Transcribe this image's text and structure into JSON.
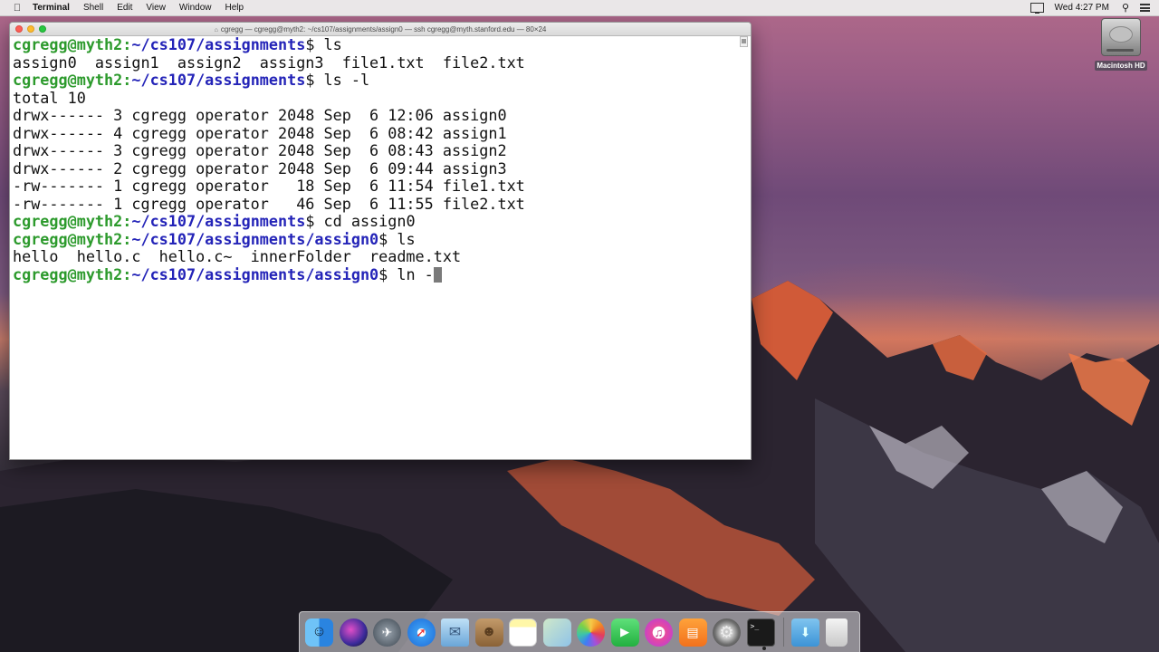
{
  "menubar": {
    "apple_icon": "apple-icon",
    "app_name": "Terminal",
    "items": [
      "Shell",
      "Edit",
      "View",
      "Window",
      "Help"
    ],
    "clock": "Wed 4:27 PM"
  },
  "desktop": {
    "drive_label": "Macintosh HD"
  },
  "terminal": {
    "title": "cgregg — cgregg@myth2: ~/cs107/assignments/assign0 — ssh cgregg@myth.stanford.edu — 80×24",
    "lines": [
      {
        "user": "cgregg@myth2",
        "path": "~/cs107/assignments",
        "cmd": "$ ls"
      },
      {
        "text": "assign0  assign1  assign2  assign3  file1.txt  file2.txt"
      },
      {
        "user": "cgregg@myth2",
        "path": "~/cs107/assignments",
        "cmd": "$ ls -l"
      },
      {
        "text": "total 10"
      },
      {
        "text": "drwx------ 3 cgregg operator 2048 Sep  6 12:06 assign0"
      },
      {
        "text": "drwx------ 4 cgregg operator 2048 Sep  6 08:42 assign1"
      },
      {
        "text": "drwx------ 3 cgregg operator 2048 Sep  6 08:43 assign2"
      },
      {
        "text": "drwx------ 2 cgregg operator 2048 Sep  6 09:44 assign3"
      },
      {
        "text": "-rw------- 1 cgregg operator   18 Sep  6 11:54 file1.txt"
      },
      {
        "text": "-rw------- 1 cgregg operator   46 Sep  6 11:55 file2.txt"
      },
      {
        "user": "cgregg@myth2",
        "path": "~/cs107/assignments",
        "cmd": "$ cd assign0"
      },
      {
        "user": "cgregg@myth2",
        "path": "~/cs107/assignments/assign0",
        "cmd": "$ ls"
      },
      {
        "text": "hello  hello.c  hello.c~  innerFolder  readme.txt"
      },
      {
        "user": "cgregg@myth2",
        "path": "~/cs107/assignments/assign0",
        "cmd": "$ ln -",
        "cursor": true
      }
    ]
  },
  "dock": {
    "apps": [
      {
        "icon": "finder-icon",
        "cls": "finder"
      },
      {
        "icon": "siri-icon",
        "cls": "siri"
      },
      {
        "icon": "launchpad-icon",
        "cls": "launchpad"
      },
      {
        "icon": "safari-icon",
        "cls": "safari"
      },
      {
        "icon": "mail-icon",
        "cls": "mail"
      },
      {
        "icon": "contacts-icon",
        "cls": "contacts"
      },
      {
        "icon": "notes-icon",
        "cls": "notes"
      },
      {
        "icon": "preview-icon",
        "cls": "preview"
      },
      {
        "icon": "photos-icon",
        "cls": "photos"
      },
      {
        "icon": "facetime-icon",
        "cls": "facetime"
      },
      {
        "icon": "itunes-icon",
        "cls": "itunes"
      },
      {
        "icon": "ibooks-icon",
        "cls": "ibooks"
      },
      {
        "icon": "system-preferences-icon",
        "cls": "prefs"
      },
      {
        "icon": "terminal-app-icon",
        "cls": "terminal-app",
        "glyph": ">_",
        "running": true
      }
    ],
    "extras": [
      {
        "icon": "downloads-icon",
        "cls": "downloads"
      },
      {
        "icon": "trash-icon",
        "cls": "trash"
      }
    ]
  }
}
